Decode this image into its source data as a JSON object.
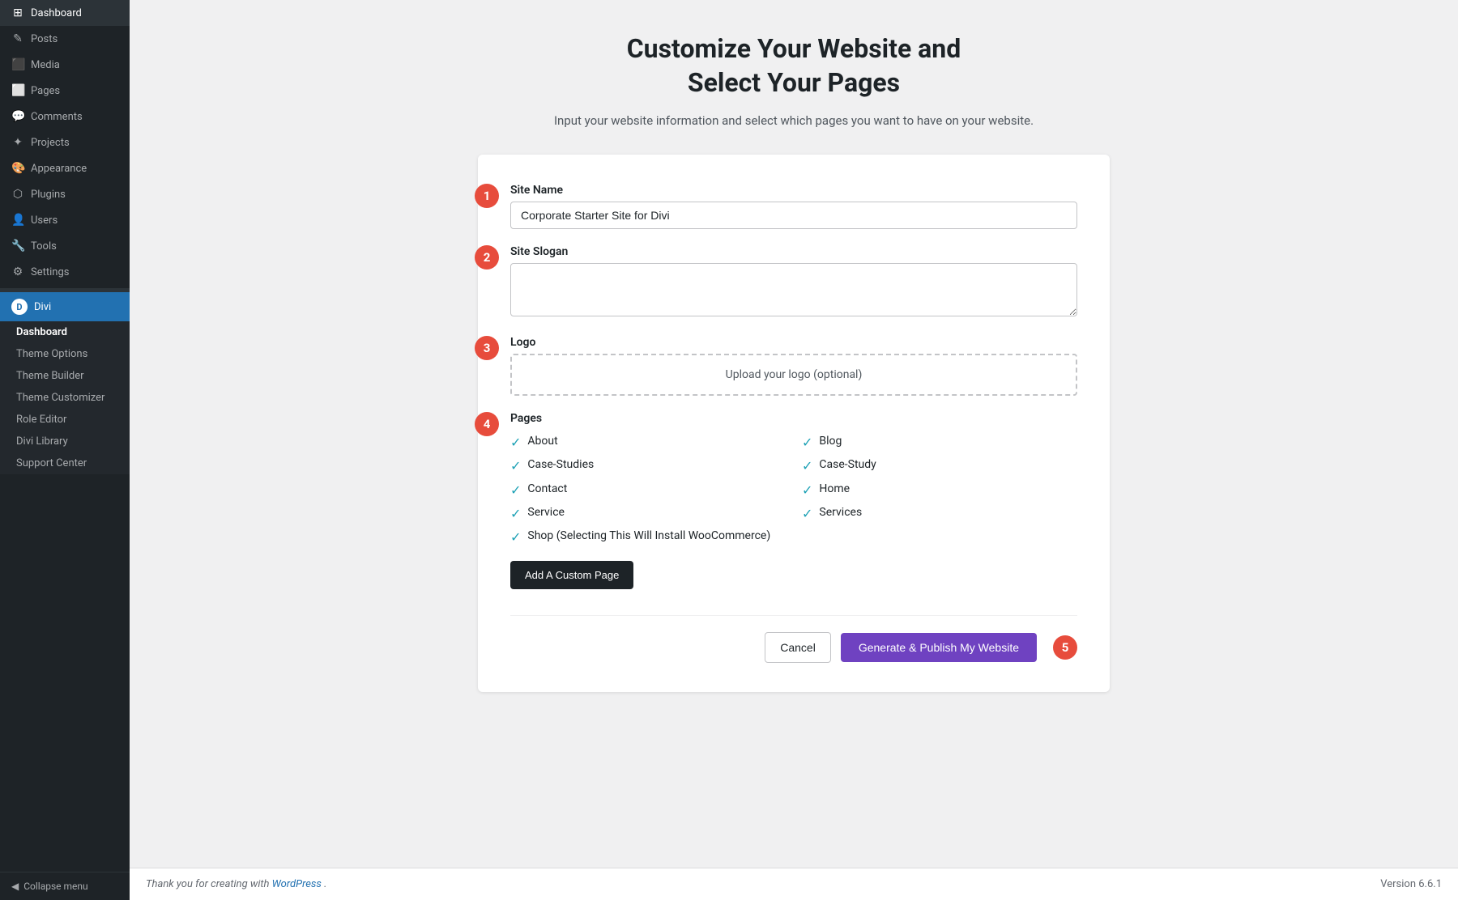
{
  "sidebar": {
    "items": [
      {
        "id": "dashboard",
        "label": "Dashboard",
        "icon": "⊞"
      },
      {
        "id": "posts",
        "label": "Posts",
        "icon": "✎"
      },
      {
        "id": "media",
        "label": "Media",
        "icon": "⬛"
      },
      {
        "id": "pages",
        "label": "Pages",
        "icon": "⬜"
      },
      {
        "id": "comments",
        "label": "Comments",
        "icon": "💬"
      },
      {
        "id": "projects",
        "label": "Projects",
        "icon": "✦"
      },
      {
        "id": "appearance",
        "label": "Appearance",
        "icon": "🎨"
      },
      {
        "id": "plugins",
        "label": "Plugins",
        "icon": "⬡"
      },
      {
        "id": "users",
        "label": "Users",
        "icon": "👤"
      },
      {
        "id": "tools",
        "label": "Tools",
        "icon": "🔧"
      },
      {
        "id": "settings",
        "label": "Settings",
        "icon": "⚙"
      }
    ],
    "divi": {
      "label": "Divi",
      "logo": "D",
      "submenu": [
        {
          "id": "dashboard-sub",
          "label": "Dashboard",
          "bold": true
        },
        {
          "id": "theme-options",
          "label": "Theme Options"
        },
        {
          "id": "theme-builder",
          "label": "Theme Builder"
        },
        {
          "id": "theme-customizer",
          "label": "Theme Customizer"
        },
        {
          "id": "role-editor",
          "label": "Role Editor"
        },
        {
          "id": "divi-library",
          "label": "Divi Library"
        },
        {
          "id": "support-center",
          "label": "Support Center"
        }
      ]
    },
    "collapse": "Collapse menu"
  },
  "main": {
    "title_line1": "Customize Your Website and",
    "title_line2": "Select Your Pages",
    "subtitle": "Input your website information and select which pages you want to have on your website.",
    "form": {
      "site_name_label": "Site Name",
      "site_name_value": "Corporate Starter Site for Divi",
      "site_slogan_label": "Site Slogan",
      "site_slogan_value": "",
      "logo_label": "Logo",
      "logo_upload_text": "Upload your logo (optional)",
      "pages_label": "Pages",
      "pages": [
        {
          "id": "about",
          "label": "About",
          "checked": true,
          "col": 1
        },
        {
          "id": "blog",
          "label": "Blog",
          "checked": true,
          "col": 2
        },
        {
          "id": "case-studies",
          "label": "Case-Studies",
          "checked": true,
          "col": 1
        },
        {
          "id": "case-study",
          "label": "Case-Study",
          "checked": true,
          "col": 2
        },
        {
          "id": "contact",
          "label": "Contact",
          "checked": true,
          "col": 1
        },
        {
          "id": "home",
          "label": "Home",
          "checked": true,
          "col": 2
        },
        {
          "id": "service",
          "label": "Service",
          "checked": true,
          "col": 1
        },
        {
          "id": "services",
          "label": "Services",
          "checked": true,
          "col": 2
        },
        {
          "id": "shop",
          "label": "Shop (Selecting This Will Install WooCommerce)",
          "checked": true,
          "col": 1
        }
      ],
      "add_custom_label": "Add A Custom Page",
      "cancel_label": "Cancel",
      "generate_label": "Generate & Publish My Website"
    }
  },
  "footer": {
    "thank_you_text": "Thank you for creating with ",
    "wordpress_link": "WordPress",
    "thank_you_suffix": ".",
    "version": "Version 6.6.1"
  },
  "steps": {
    "s1": "1",
    "s2": "2",
    "s3": "3",
    "s4": "4",
    "s5": "5"
  }
}
